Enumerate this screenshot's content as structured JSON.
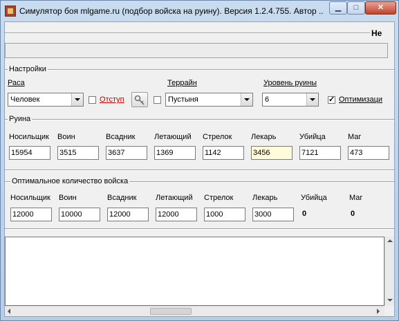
{
  "window": {
    "title": "Симулятор боя  mlgame.ru (подбор войска на руину). Версия 1.2.4.755. Автор ...",
    "minimize_glyph": "▁",
    "maximize_glyph": "□",
    "close_glyph": "✕"
  },
  "marquee_text": "Не",
  "settings": {
    "group_title": "Настройки",
    "race_label": "Раса",
    "race_value": "Человек",
    "retreat_label": "Отступ",
    "retreat_checked": false,
    "key_button_icon": "key-icon",
    "terrain_checkbox_checked": false,
    "terrain_label": "Террайн",
    "terrain_value": "Пустыня",
    "ruin_level_label": "Уровень руины",
    "ruin_level_value": "6",
    "optimization_label": "Оптимизаци",
    "optimization_checked": true,
    "retreat_color": "#cc0000"
  },
  "ruin": {
    "group_title": "Руина",
    "units": [
      {
        "label": "Носильщик",
        "value": "15954"
      },
      {
        "label": "Воин",
        "value": "3515"
      },
      {
        "label": "Всадник",
        "value": "3637"
      },
      {
        "label": "Летающий",
        "value": "1369"
      },
      {
        "label": "Стрелок",
        "value": "1142"
      },
      {
        "label": "Лекарь",
        "value": "3456"
      },
      {
        "label": "Убийца",
        "value": "7121"
      },
      {
        "label": "Маг",
        "value": "473"
      }
    ]
  },
  "optimal": {
    "group_title": "Оптимальное количество войска",
    "units": [
      {
        "label": "Носильщик",
        "value": "12000"
      },
      {
        "label": "Воин",
        "value": "10000"
      },
      {
        "label": "Всадник",
        "value": "12000"
      },
      {
        "label": "Летающий",
        "value": "12000"
      },
      {
        "label": "Стрелок",
        "value": "1000"
      },
      {
        "label": "Лекарь",
        "value": "3000"
      },
      {
        "label": "Убийца",
        "value": "0"
      },
      {
        "label": "Маг",
        "value": "0"
      }
    ]
  }
}
